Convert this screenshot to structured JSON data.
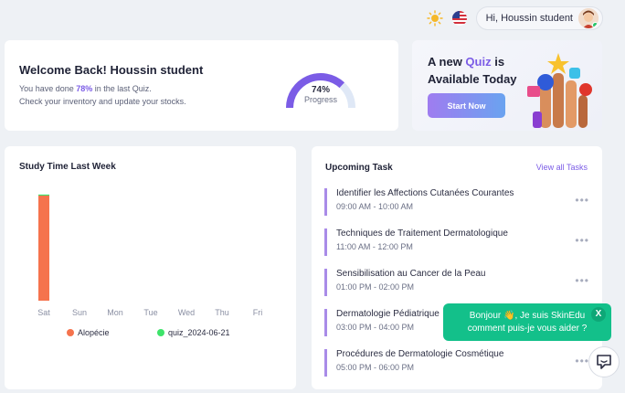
{
  "header": {
    "greeting": "Hi, Houssin student",
    "theme_icon": "sun-icon",
    "language_icon": "us-flag-icon"
  },
  "welcome": {
    "title": "Welcome Back! Houssin student",
    "line1_prefix": "You have done ",
    "line1_pct": "78%",
    "line1_suffix": " in the last Quiz.",
    "line2": "Check your inventory and update your stocks.",
    "progress_value": "74%",
    "progress_label": "Progress",
    "progress_fraction": 0.74
  },
  "quiz": {
    "line1_prefix": "A new ",
    "line1_highlight": "Quiz",
    "line1_suffix": " is",
    "line2": "Available Today",
    "button": "Start Now"
  },
  "chart_data": {
    "type": "bar",
    "title": "Study Time Last Week",
    "categories": [
      "Sat",
      "Sun",
      "Mon",
      "Tue",
      "Wed",
      "Thu",
      "Fri"
    ],
    "series": [
      {
        "name": "Alopécie",
        "color": "#f5734d",
        "values": [
          1,
          0,
          0,
          0,
          0,
          0,
          0
        ]
      },
      {
        "name": "quiz_2024-06-21",
        "color": "#3ee36a",
        "values": [
          0.01,
          0,
          0,
          0,
          0,
          0,
          0
        ]
      }
    ],
    "legend": "bottom",
    "grid": false
  },
  "tasks": {
    "title": "Upcoming Task",
    "view_all": "View all Tasks",
    "items": [
      {
        "name": "Identifier les Affections Cutanées Courantes",
        "time": "09:00 AM - 10:00 AM"
      },
      {
        "name": "Techniques de Traitement Dermatologique",
        "time": "11:00 AM - 12:00 PM"
      },
      {
        "name": "Sensibilisation au Cancer de la Peau",
        "time": "01:00 PM - 02:00 PM"
      },
      {
        "name": "Dermatologie Pédiatrique",
        "time": "03:00 PM - 04:00 PM"
      },
      {
        "name": "Procédures de Dermatologie Cosmétique",
        "time": "05:00 PM - 06:00 PM"
      }
    ],
    "more": "•••"
  },
  "chat": {
    "line1": "Bonjour 👋, Je suis SkinEdu",
    "line2": "comment puis-je vous aider ?",
    "close": "X"
  },
  "colors": {
    "accent": "#7b5ce6",
    "chat": "#13c08a"
  }
}
